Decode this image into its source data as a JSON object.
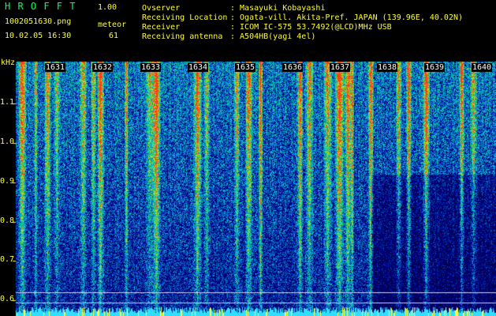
{
  "header": {
    "app_name": "H R O F F T",
    "version": "1.00",
    "filename": "1002051630.png",
    "timestamp": "10.02.05 16:30",
    "meteor_label": "meteor",
    "meteor_count": "61",
    "info": [
      {
        "label": "Ovserver",
        "value": ": Masayuki Kobayashi"
      },
      {
        "label": "Receiving Location",
        "value": ": Ogata-vill. Akita-Pref. JAPAN (139.96E, 40.02N)"
      },
      {
        "label": "Receiver",
        "value": ": ICOM IC-575 53.7492(@LCD)MHz USB"
      },
      {
        "label": "Receiving antenna",
        "value": ": A504HB(yagi 4el)"
      }
    ]
  },
  "colors": {
    "title": "#00ff66",
    "labels": "#ffff33",
    "background": "#000000",
    "spectrogram_base": "#00008c"
  },
  "axis": {
    "y_unit": "kHz",
    "y_ticks": [
      "1.1",
      "1.0",
      "0.9",
      "0.8",
      "0.7",
      "0.6"
    ],
    "x_ticks": [
      "1631",
      "1632",
      "1633",
      "1634",
      "1635",
      "1636",
      "1637",
      "1638",
      "1639",
      "1640"
    ]
  }
}
